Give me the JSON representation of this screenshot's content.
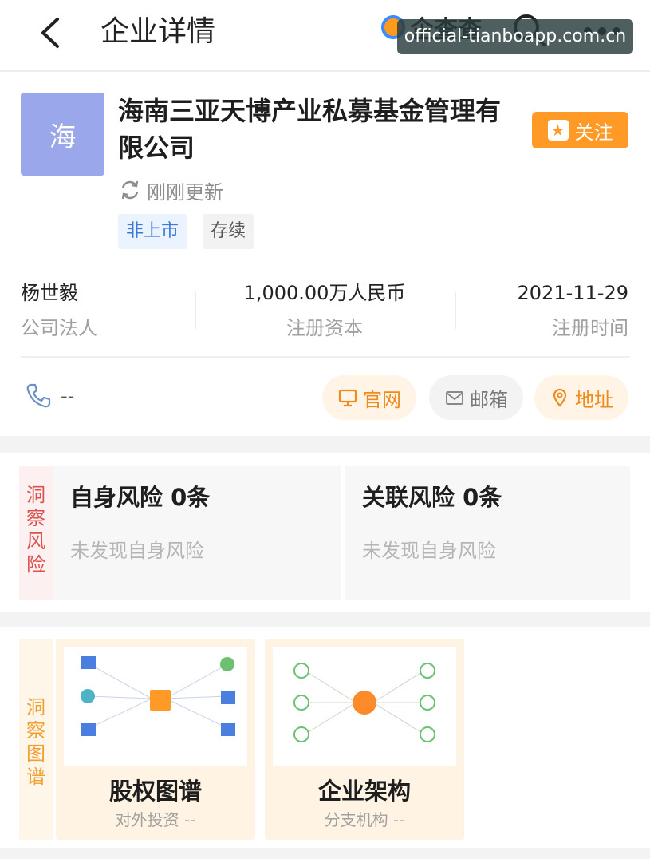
{
  "header": {
    "title": "企业详情",
    "brand": "企查查",
    "watermark": "official-tianboapp.com.cn"
  },
  "company": {
    "avatar_char": "海",
    "name": "海南三亚天博产业私募基金管理有限公司",
    "follow_label": "关注",
    "update_text": "刚刚更新",
    "tags": [
      "非上市",
      "存续"
    ]
  },
  "info": [
    {
      "value": "杨世毅",
      "label": "公司法人"
    },
    {
      "value": "1,000.00万人民币",
      "label": "注册资本"
    },
    {
      "value": "2021-11-29",
      "label": "注册时间"
    }
  ],
  "contact": {
    "phone": "--",
    "website_label": "官网",
    "email_label": "邮箱",
    "address_label": "地址"
  },
  "risk": {
    "side_label": "洞察风险",
    "self": {
      "title": "自身风险 0条",
      "desc": "未发现自身风险"
    },
    "related": {
      "title": "关联风险 0条",
      "desc": "未发现自身风险"
    }
  },
  "graph": {
    "side_label": "洞察图谱",
    "equity": {
      "title": "股权图谱",
      "sub": "对外投资 --"
    },
    "structure": {
      "title": "企业架构",
      "sub": "分支机构 --"
    }
  },
  "colors": {
    "accent": "#ff9a26",
    "avatar": "#9aa7ea",
    "risk_red": "#d9534f",
    "tag_blue": "#3a7ad9"
  }
}
